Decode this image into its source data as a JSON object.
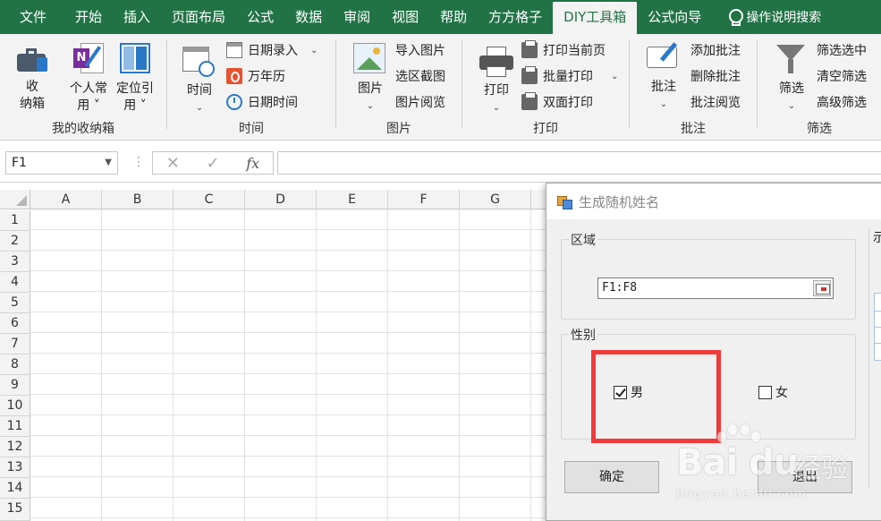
{
  "menubar": {
    "tabs": [
      "文件",
      "开始",
      "插入",
      "页面布局",
      "公式",
      "数据",
      "审阅",
      "视图",
      "帮助",
      "方方格子",
      "DIY工具箱",
      "公式向导"
    ],
    "active_tab": "DIY工具箱",
    "help": "操作说明搜索"
  },
  "ribbon": {
    "groups": {
      "storage": {
        "title": "我的收纳箱",
        "box": "收\n纳箱",
        "personal": "个人常\n用 ˅",
        "locate": "定位引\n用 ˅"
      },
      "time": {
        "title": "时间",
        "time_btn": "时间",
        "date_entry": "日期录入",
        "calendar": "万年历",
        "datetime": "日期时间"
      },
      "picture": {
        "title": "图片",
        "picture_btn": "图片",
        "import": "导入图片",
        "screenshot": "选区截图",
        "browse": "图片阅览"
      },
      "print": {
        "title": "打印",
        "print_btn": "打印",
        "current": "打印当前页",
        "batch": "批量打印",
        "duplex": "双面打印"
      },
      "comment": {
        "title": "批注",
        "comment_btn": "批注",
        "add": "添加批注",
        "delete": "删除批注",
        "browse": "批注阅览"
      },
      "filter": {
        "title": "筛选",
        "filter_btn": "筛选",
        "selected": "筛选选中",
        "clear": "清空筛选",
        "advanced": "高级筛选"
      }
    }
  },
  "formula_bar": {
    "name_box": "F1",
    "fx": "fx"
  },
  "grid": {
    "columns": [
      "A",
      "B",
      "C",
      "D",
      "E",
      "F",
      "G"
    ],
    "rows": [
      "1",
      "2",
      "3",
      "4",
      "5",
      "6",
      "7",
      "8",
      "9",
      "10",
      "11",
      "12",
      "13",
      "14",
      "15"
    ]
  },
  "dialog": {
    "title": "生成随机姓名",
    "region_label": "区域",
    "range_value": "F1:F8",
    "gender_label": "性别",
    "male_label": "男",
    "male_checked": true,
    "female_label": "女",
    "female_checked": false,
    "ok_label": "确定",
    "exit_label": "退出",
    "right_partial": "示"
  },
  "watermark": {
    "logo": "Bai du",
    "text": "经验",
    "url": "jingyan.baidu.com"
  },
  "colors": {
    "menubar_bg": "#217346",
    "highlight": "#f03a3a"
  }
}
